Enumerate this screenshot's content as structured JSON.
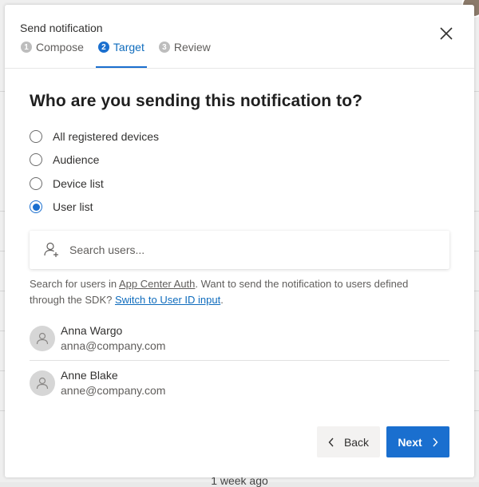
{
  "background": {
    "footer_text": "1 week ago"
  },
  "modal": {
    "title": "Send notification",
    "close_icon": "close-icon",
    "steps": [
      {
        "number": "1",
        "label": "Compose",
        "active": false
      },
      {
        "number": "2",
        "label": "Target",
        "active": true
      },
      {
        "number": "3",
        "label": "Review",
        "active": false
      }
    ],
    "question": "Who are you sending this notification to?",
    "options": [
      {
        "label": "All registered devices",
        "checked": false
      },
      {
        "label": "Audience",
        "checked": false
      },
      {
        "label": "Device list",
        "checked": false
      },
      {
        "label": "User list",
        "checked": true
      }
    ],
    "search": {
      "placeholder": "Search users...",
      "value": "",
      "icon": "add-person-icon"
    },
    "help": {
      "part1": "Search for users in ",
      "auth_link": "App Center Auth",
      "part2": ". Want to send the notification to users defined through the SDK? ",
      "switch_link": "Switch to User ID input",
      "part3": "."
    },
    "users": [
      {
        "name": "Anna Wargo",
        "email": "anna@company.com"
      },
      {
        "name": "Anne Blake",
        "email": "anne@company.com"
      }
    ],
    "buttons": {
      "back": "Back",
      "next": "Next"
    }
  },
  "colors": {
    "accent": "#1a6fcf",
    "link": "#0f6cbd",
    "secondary_button": "#f3f2f1"
  }
}
